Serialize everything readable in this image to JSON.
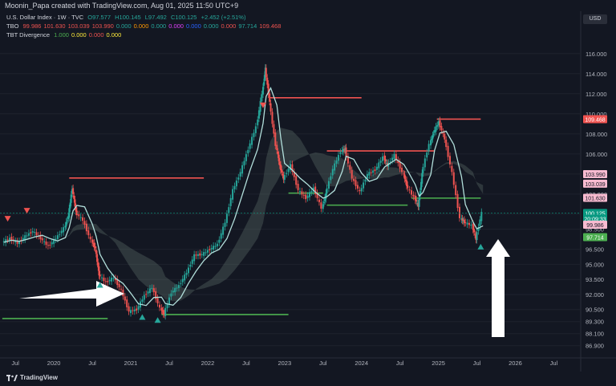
{
  "header": {
    "credit": "Moonin_Papa created with TradingView.com, Aug 01, 2025 11:50 UTC+9"
  },
  "legend": {
    "line1": {
      "name": "U.S. Dollar Index · 1W · TVC",
      "O": "O97.577",
      "H": "H100.145",
      "L": "L97.492",
      "C": "C100.125",
      "chg": "+2.452 (+2.51%)"
    },
    "line2": {
      "name": "TBO",
      "values": [
        "99.986",
        "101.630",
        "103.039",
        "103.990",
        "0.000",
        "0.000",
        "0.000",
        "0.000",
        "0.000",
        "0.000",
        "0.000",
        "97.714",
        "109.468"
      ],
      "colors": [
        "#ef5350",
        "#ef5350",
        "#ef5350",
        "#ef5350",
        "#26a69a",
        "#ff9800",
        "#26a69a",
        "#e040fb",
        "#2962ff",
        "#26a69a",
        "#ef5350",
        "#26a69a",
        "#ef5350"
      ]
    },
    "line3": {
      "name": "TBT Divergence",
      "values": [
        "1.000",
        "0.000",
        "0.000",
        "0.000"
      ],
      "colors": [
        "#4caf50",
        "#ffeb3b",
        "#ef5350",
        "#ffeb3b"
      ]
    }
  },
  "currency_button": "USD",
  "branding": "TradingView",
  "chart_data": {
    "type": "line",
    "ylim": [
      86.0,
      117.5
    ],
    "y_ticks": [
      "116.000",
      "114.000",
      "112.000",
      "110.000",
      "108.000",
      "106.000",
      "104.000",
      "102.000",
      "100.000",
      "98.500",
      "96.500",
      "95.000",
      "93.500",
      "92.000",
      "90.500",
      "89.300",
      "88.100",
      "86.900"
    ],
    "x_ticks": [
      "Jul",
      "2020",
      "Jul",
      "2021",
      "Jul",
      "2022",
      "Jul",
      "2023",
      "Jul",
      "2024",
      "Jul",
      "2025",
      "Jul",
      "2026",
      "Jul"
    ],
    "x_range": [
      2019.3,
      2026.85
    ],
    "price_labels": [
      {
        "text": "109.468",
        "value": 109.468,
        "bg": "#f05350",
        "fg": "#ffffff"
      },
      {
        "text": "103.990",
        "value": 103.99,
        "bg": "#f8bbd0",
        "fg": "#131722"
      },
      {
        "text": "103.039",
        "value": 103.039,
        "bg": "#f8bbd0",
        "fg": "#131722"
      },
      {
        "text": "101.630",
        "value": 101.63,
        "bg": "#f8bbd0",
        "fg": "#131722"
      },
      {
        "text": "100.125",
        "value": 100.125,
        "bg": "#089981",
        "fg": "#ffffff"
      },
      {
        "text": "20:09:33",
        "value": 99.55,
        "bg": "#089981",
        "fg": "#ffffff"
      },
      {
        "text": "99.986",
        "value": 98.95,
        "bg": "#f8bbd0",
        "fg": "#131722"
      },
      {
        "text": "97.714",
        "value": 97.714,
        "bg": "#4caf50",
        "fg": "#ffffff"
      }
    ],
    "series": [
      {
        "values": [
          [
            2019.35,
            97.2
          ],
          [
            2019.45,
            97.6
          ],
          [
            2019.55,
            97.1
          ],
          [
            2019.65,
            97.8
          ],
          [
            2019.75,
            98.3
          ],
          [
            2019.85,
            97.6
          ],
          [
            2019.95,
            96.8
          ],
          [
            2020.05,
            97.6
          ],
          [
            2020.15,
            98.6
          ],
          [
            2020.2,
            99.8
          ],
          [
            2020.25,
            102.6
          ],
          [
            2020.3,
            100.2
          ],
          [
            2020.4,
            99.4
          ],
          [
            2020.5,
            97.4
          ],
          [
            2020.55,
            96.6
          ],
          [
            2020.6,
            94.0
          ],
          [
            2020.7,
            93.2
          ],
          [
            2020.8,
            93.7
          ],
          [
            2020.9,
            92.4
          ],
          [
            2021.0,
            90.3
          ],
          [
            2021.1,
            90.5
          ],
          [
            2021.2,
            91.9
          ],
          [
            2021.3,
            92.7
          ],
          [
            2021.4,
            90.6
          ],
          [
            2021.45,
            90.0
          ],
          [
            2021.55,
            92.2
          ],
          [
            2021.65,
            92.9
          ],
          [
            2021.75,
            94.2
          ],
          [
            2021.85,
            95.9
          ],
          [
            2021.95,
            96.0
          ],
          [
            2022.05,
            96.5
          ],
          [
            2022.15,
            97.0
          ],
          [
            2022.25,
            99.2
          ],
          [
            2022.35,
            102.4
          ],
          [
            2022.45,
            104.2
          ],
          [
            2022.55,
            106.5
          ],
          [
            2022.65,
            108.7
          ],
          [
            2022.72,
            112.0
          ],
          [
            2022.76,
            114.5
          ],
          [
            2022.82,
            111.2
          ],
          [
            2022.9,
            106.9
          ],
          [
            2022.95,
            104.8
          ],
          [
            2023.0,
            103.5
          ],
          [
            2023.1,
            104.9
          ],
          [
            2023.2,
            102.4
          ],
          [
            2023.3,
            101.6
          ],
          [
            2023.4,
            102.6
          ],
          [
            2023.5,
            100.6
          ],
          [
            2023.55,
            102.0
          ],
          [
            2023.65,
            104.5
          ],
          [
            2023.75,
            106.3
          ],
          [
            2023.8,
            106.5
          ],
          [
            2023.9,
            103.6
          ],
          [
            2024.0,
            102.2
          ],
          [
            2024.1,
            104.0
          ],
          [
            2024.2,
            104.4
          ],
          [
            2024.3,
            105.7
          ],
          [
            2024.35,
            104.8
          ],
          [
            2024.45,
            105.9
          ],
          [
            2024.55,
            104.2
          ],
          [
            2024.6,
            102.9
          ],
          [
            2024.7,
            101.7
          ],
          [
            2024.75,
            100.8
          ],
          [
            2024.8,
            104.0
          ],
          [
            2024.9,
            107.0
          ],
          [
            2024.95,
            108.1
          ],
          [
            2025.02,
            109.2
          ],
          [
            2025.1,
            107.5
          ],
          [
            2025.2,
            104.1
          ],
          [
            2025.3,
            99.6
          ],
          [
            2025.35,
            99.2
          ],
          [
            2025.45,
            98.9
          ],
          [
            2025.5,
            97.5
          ],
          [
            2025.58,
            100.125
          ]
        ]
      }
    ],
    "levels": [
      {
        "y": 103.6,
        "x0": 2020.2,
        "x1": 2021.95,
        "color": "resistance"
      },
      {
        "y": 89.6,
        "x0": 2019.33,
        "x1": 2020.7,
        "color": "support"
      },
      {
        "y": 90.0,
        "x0": 2021.4,
        "x1": 2023.05,
        "color": "support"
      },
      {
        "y": 111.6,
        "x0": 2022.8,
        "x1": 2024.0,
        "color": "resistance"
      },
      {
        "y": 102.1,
        "x0": 2023.05,
        "x1": 2023.5,
        "color": "support"
      },
      {
        "y": 106.3,
        "x0": 2023.55,
        "x1": 2024.95,
        "color": "resistance"
      },
      {
        "y": 100.9,
        "x0": 2023.55,
        "x1": 2024.6,
        "color": "support"
      },
      {
        "y": 109.468,
        "x0": 2024.98,
        "x1": 2025.55,
        "color": "resistance"
      },
      {
        "y": 101.6,
        "x0": 2024.65,
        "x1": 2025.55,
        "color": "support"
      }
    ]
  }
}
